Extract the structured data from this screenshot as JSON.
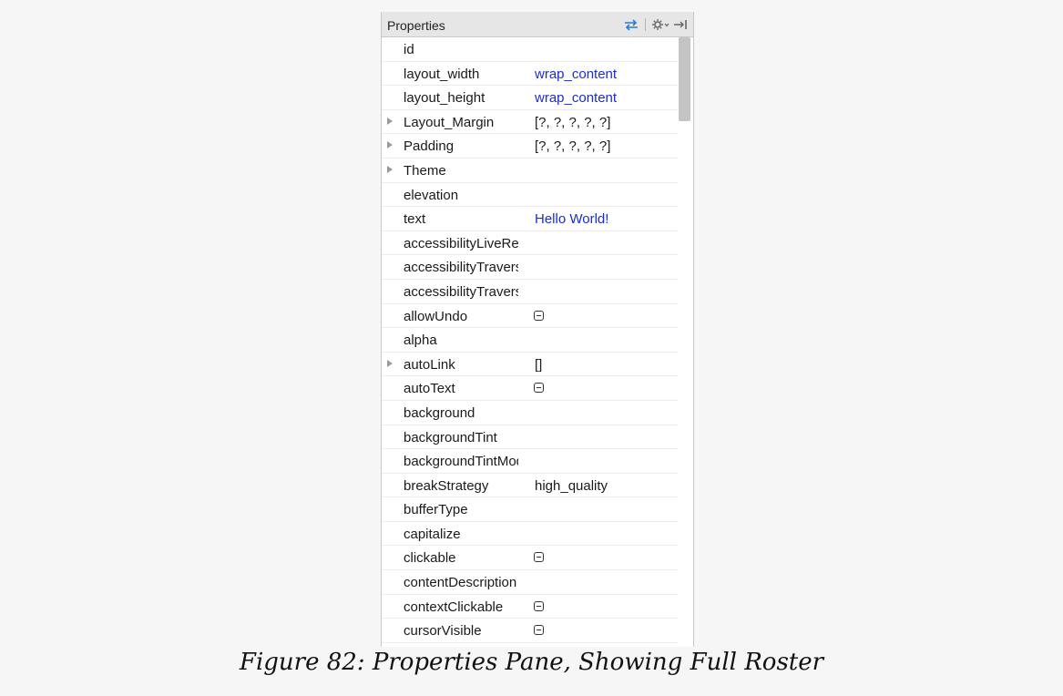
{
  "panel": {
    "title": "Properties",
    "tools": [
      {
        "icon": "swap-arrows-icon"
      },
      {
        "icon": "gear-icon"
      },
      {
        "icon": "pin-to-edge-icon"
      }
    ]
  },
  "rows": [
    {
      "name": "id",
      "value": "",
      "kind": "text",
      "expandable": false
    },
    {
      "name": "layout_width",
      "value": "wrap_content",
      "kind": "set",
      "expandable": false
    },
    {
      "name": "layout_height",
      "value": "wrap_content",
      "kind": "set",
      "expandable": false
    },
    {
      "name": "Layout_Margin",
      "value": "[?, ?, ?, ?, ?]",
      "kind": "text",
      "expandable": true
    },
    {
      "name": "Padding",
      "value": "[?, ?, ?, ?, ?]",
      "kind": "text",
      "expandable": true
    },
    {
      "name": "Theme",
      "value": "",
      "kind": "text",
      "expandable": true
    },
    {
      "name": "elevation",
      "value": "",
      "kind": "text",
      "expandable": false
    },
    {
      "name": "text",
      "value": "Hello World!",
      "kind": "set",
      "expandable": false
    },
    {
      "name": "accessibilityLiveRegion",
      "value": "",
      "kind": "text",
      "expandable": false
    },
    {
      "name": "accessibilityTraversalAfter",
      "value": "",
      "kind": "text",
      "expandable": false
    },
    {
      "name": "accessibilityTraversalBefore",
      "value": "",
      "kind": "text",
      "expandable": false
    },
    {
      "name": "allowUndo",
      "value": "",
      "kind": "checkbox",
      "expandable": false
    },
    {
      "name": "alpha",
      "value": "",
      "kind": "text",
      "expandable": false
    },
    {
      "name": "autoLink",
      "value": "[]",
      "kind": "text",
      "expandable": true
    },
    {
      "name": "autoText",
      "value": "",
      "kind": "checkbox",
      "expandable": false
    },
    {
      "name": "background",
      "value": "",
      "kind": "text",
      "expandable": false
    },
    {
      "name": "backgroundTint",
      "value": "",
      "kind": "text",
      "expandable": false
    },
    {
      "name": "backgroundTintMode",
      "value": "",
      "kind": "text",
      "expandable": false
    },
    {
      "name": "breakStrategy",
      "value": "high_quality",
      "kind": "text",
      "expandable": false
    },
    {
      "name": "bufferType",
      "value": "",
      "kind": "text",
      "expandable": false
    },
    {
      "name": "capitalize",
      "value": "",
      "kind": "text",
      "expandable": false
    },
    {
      "name": "clickable",
      "value": "",
      "kind": "checkbox",
      "expandable": false
    },
    {
      "name": "contentDescription",
      "value": "",
      "kind": "text",
      "expandable": false
    },
    {
      "name": "contextClickable",
      "value": "",
      "kind": "checkbox",
      "expandable": false
    },
    {
      "name": "cursorVisible",
      "value": "",
      "kind": "checkbox",
      "expandable": false
    }
  ],
  "caption": "Figure 82: Properties Pane, Showing Full Roster",
  "colors": {
    "set_value": "#1a2cd6",
    "header_bg": "#e6e6e6",
    "tool_accent": "#2a7bd4"
  }
}
